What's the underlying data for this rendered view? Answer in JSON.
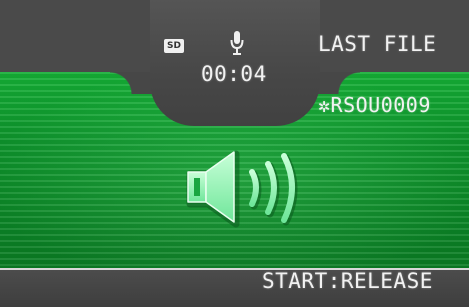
{
  "status": {
    "storage_icon": "sd-card-icon",
    "storage_label": "SD",
    "record_icon": "microphone-icon",
    "elapsed_time": "00:04",
    "file_position": "LAST FILE",
    "file_name": "✲RSOU0009"
  },
  "playback": {
    "icon": "speaker-volume-icon"
  },
  "footer": {
    "hint": "START:RELEASE"
  },
  "colors": {
    "playback_green": "#0fa631",
    "panel_grey": "#474747",
    "text": "#f2f2f2"
  }
}
